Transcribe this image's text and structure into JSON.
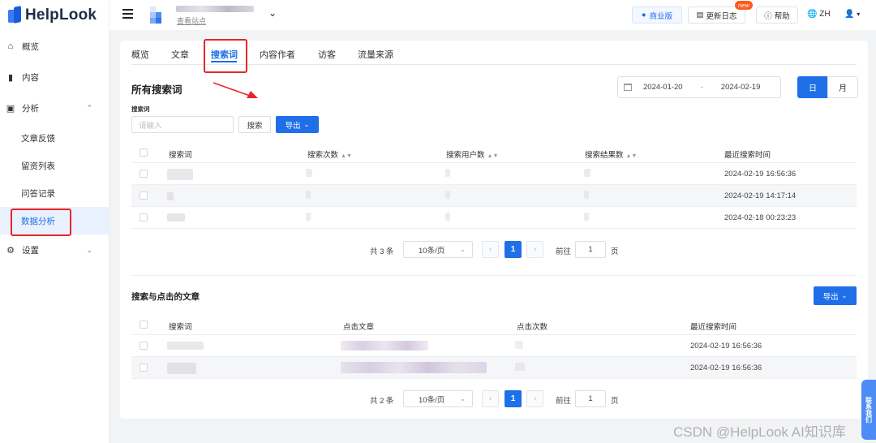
{
  "app": {
    "logo_text": "HelpLook"
  },
  "sidebar": {
    "items": [
      {
        "label": "概览",
        "icon": "home-icon"
      },
      {
        "label": "内容",
        "icon": "book-icon"
      },
      {
        "label": "分析",
        "icon": "chart-icon"
      },
      {
        "label": "设置",
        "icon": "gear-icon"
      }
    ],
    "sub_items": [
      {
        "label": "文章反馈"
      },
      {
        "label": "留资列表"
      },
      {
        "label": "问答记录"
      },
      {
        "label": "数据分析",
        "active": true
      }
    ]
  },
  "topbar": {
    "site_link": "查看站点",
    "business_label": "商业版",
    "changelog_label": "更新日志",
    "new_badge": "new",
    "help_label": "帮助",
    "lang_label": "ZH"
  },
  "tabs": [
    {
      "label": "概览"
    },
    {
      "label": "文章"
    },
    {
      "label": "搜索词",
      "active": true
    },
    {
      "label": "内容作者"
    },
    {
      "label": "访客"
    },
    {
      "label": "流量来源"
    }
  ],
  "search_terms": {
    "title": "所有搜索词",
    "date_start": "2024-01-20",
    "date_sep": "-",
    "date_end": "2024-02-19",
    "period_day": "日",
    "period_month": "月",
    "filter_label": "搜索词",
    "input_placeholder": "请输入",
    "search_button": "搜索",
    "export_button": "导出",
    "columns": [
      "搜索词",
      "搜索次数",
      "搜索用户数",
      "搜索结果数",
      "最近搜索时间"
    ],
    "rows": [
      {
        "last_time": "2024-02-19 16:56:36"
      },
      {
        "last_time": "2024-02-19 14:17:14"
      },
      {
        "last_time": "2024-02-18 00:23:23"
      }
    ],
    "pagination": {
      "total": "共 3 条",
      "page_size": "10条/页",
      "current": "1",
      "goto": "前往",
      "goto_value": "1",
      "page_unit": "页"
    }
  },
  "click_articles": {
    "title": "搜索与点击的文章",
    "export_button": "导出",
    "columns": [
      "搜索词",
      "点击文章",
      "点击次数",
      "最近搜索时间"
    ],
    "rows": [
      {
        "last_time": "2024-02-19 16:56:36"
      },
      {
        "last_time": "2024-02-19 16:56:36"
      }
    ],
    "pagination": {
      "total": "共 2 条",
      "page_size": "10条/页",
      "current": "1",
      "goto": "前往",
      "goto_value": "1",
      "page_unit": "页"
    }
  },
  "side_tab": "联系我们",
  "watermark": "CSDN @HelpLook AI知识库",
  "colors": {
    "accent": "#1e6fe8",
    "highlight_box": "#e8242a",
    "new_badge": "#ff5a1f"
  }
}
